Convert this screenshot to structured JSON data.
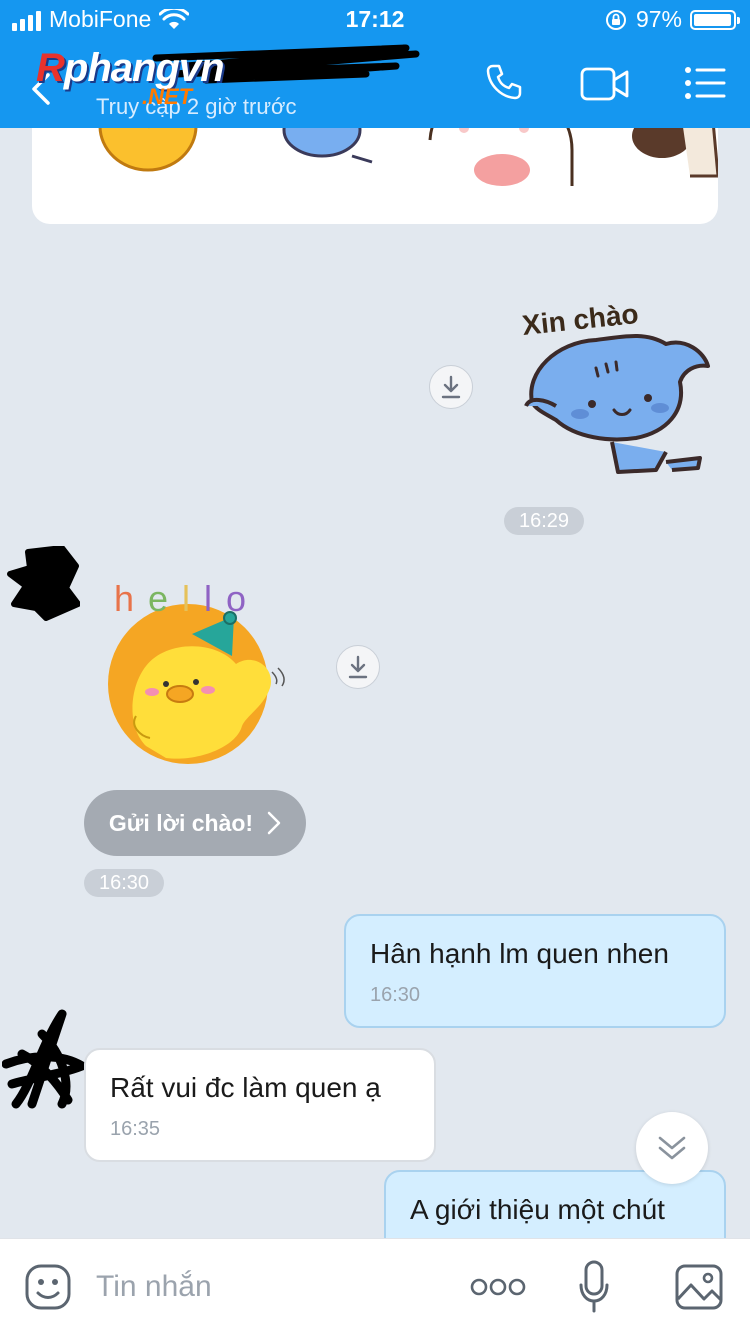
{
  "status_bar": {
    "carrier": "MobiFone",
    "time": "17:12",
    "battery": "97%",
    "battery_level": 0.97
  },
  "header": {
    "watermark_logo": "Rphangvn .NET",
    "subtitle": "Truy cập 2 giờ trước",
    "icons": [
      "back-icon",
      "phone-icon",
      "video-call-icon",
      "menu-icon"
    ]
  },
  "chat": {
    "sticker_1_text": "Xin chào",
    "time_1": "16:29",
    "sticker_2_text": "hello",
    "greet_button": "Gửi lời chào!",
    "time_2": "16:30",
    "messages": [
      {
        "direction": "out",
        "text": "Hân hạnh lm quen nhen",
        "time": "16:30"
      },
      {
        "direction": "in",
        "text": "Rất vui đc làm quen ạ",
        "time": "16:35"
      },
      {
        "direction": "out",
        "text": "A giới thiệu một chút",
        "time": ""
      }
    ]
  },
  "input_bar": {
    "placeholder": "Tin nhắn",
    "icons": [
      "emoji-icon",
      "more-icon",
      "microphone-icon",
      "image-icon"
    ]
  },
  "colors": {
    "header": "#1597f0",
    "chat_bg": "#e2e8ef",
    "outgoing_bubble": "#d4eeff",
    "incoming_bubble": "#ffffff"
  }
}
